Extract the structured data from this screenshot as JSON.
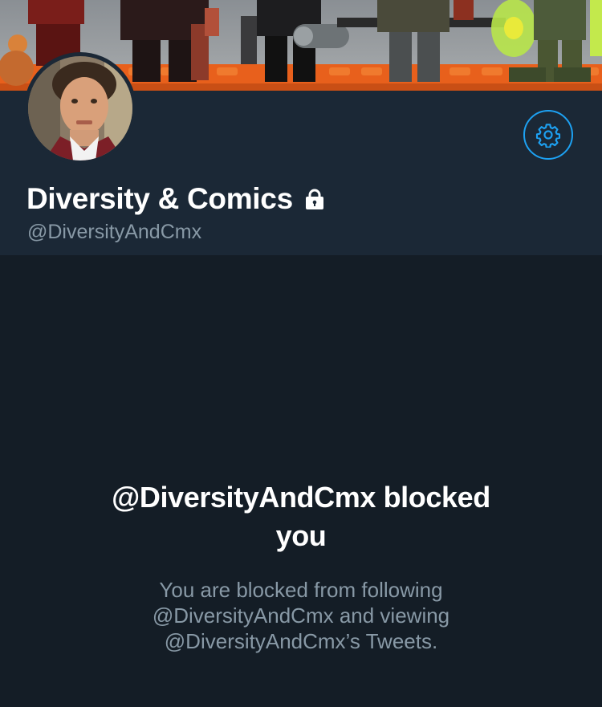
{
  "profile": {
    "display_name": "Diversity & Comics",
    "handle": "@DiversityAndCmx",
    "protected": true
  },
  "blocked_notice": {
    "title_line_1": "@DiversityAndCmx blocked",
    "title_line_2": "you",
    "body_line_1": "You are blocked from following",
    "body_line_2": "@DiversityAndCmx and viewing",
    "body_line_3": "@DiversityAndCmx’s Tweets."
  },
  "icons": {
    "settings": "gear-icon",
    "protected": "lock-icon"
  },
  "colors": {
    "background": "#141d26",
    "header_background": "#1b2836",
    "accent": "#1da1f2",
    "secondary_text": "#8899a6",
    "primary_text": "#ffffff"
  }
}
